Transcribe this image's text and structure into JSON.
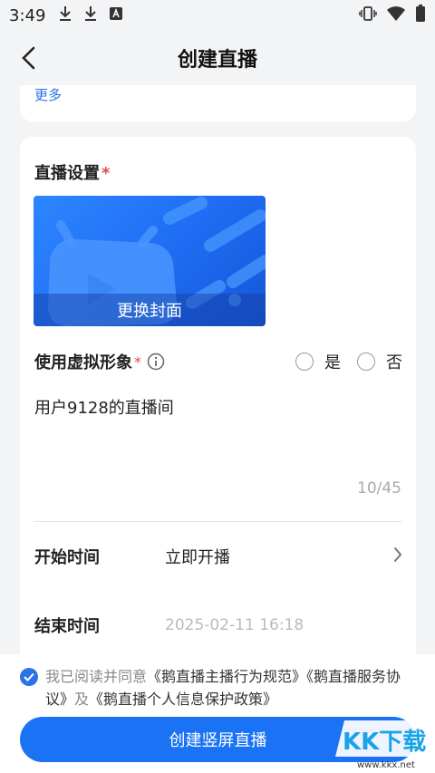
{
  "status_bar": {
    "time": "3:49",
    "icons": [
      "download-icon",
      "download-icon",
      "text-badge-icon",
      "vibrate-icon",
      "wifi-icon",
      "battery-icon"
    ]
  },
  "header": {
    "title": "创建直播",
    "back_icon": "chevron-left-icon"
  },
  "top_card": {
    "more_link": "更多"
  },
  "settings": {
    "section_title": "直播设置",
    "required_mark": "*",
    "cover_button": "更换封面",
    "virtual_label": "使用虚拟形象",
    "virtual_required": "*",
    "virtual_options": [
      "是",
      "否"
    ],
    "virtual_selected": null,
    "room_name": "用户9128的直播间",
    "room_name_counter": "10/45",
    "start_time_label": "开始时间",
    "start_time_value": "立即开播",
    "end_time_label": "结束时间",
    "end_time_value": "2025-02-11 16:18"
  },
  "agreement": {
    "checked": true,
    "prefix": "我已阅读并同意",
    "doc1": "《鹅直播主播行为规范》",
    "doc2": "《鹅直播服务协议》",
    "joiner": "及",
    "doc3": "《鹅直播个人信息保护政策》"
  },
  "footer": {
    "create_button": "创建竖屏直播"
  },
  "watermark": {
    "text": "KK下载",
    "url": "www.kkx.net"
  },
  "colors": {
    "accent": "#1a73f5",
    "link": "#2a72e8",
    "required": "#e5484d",
    "background": "#f3f4f6"
  }
}
